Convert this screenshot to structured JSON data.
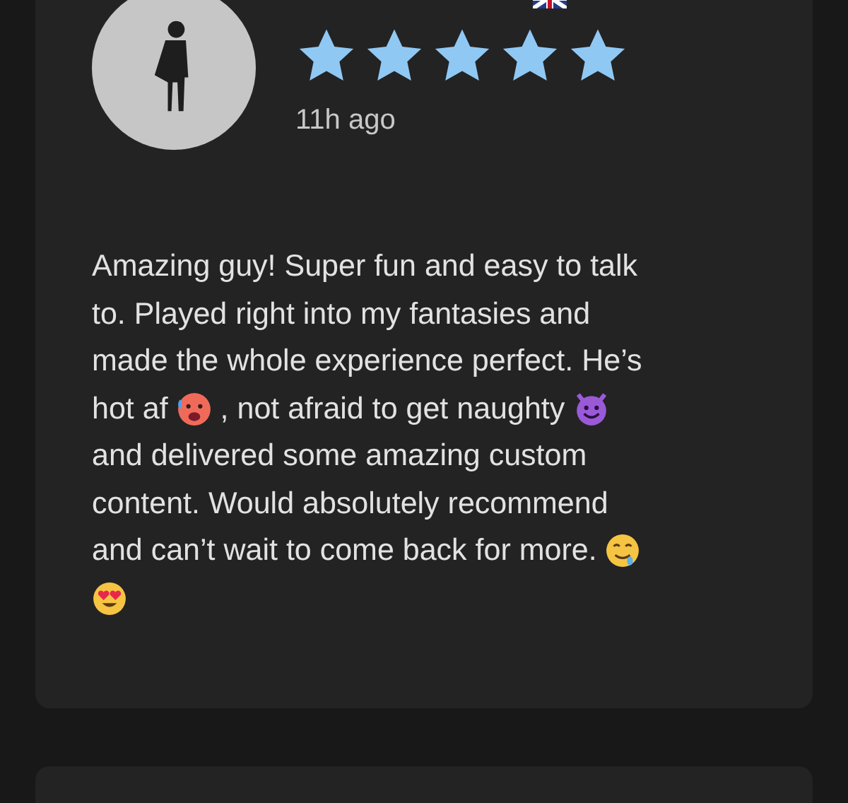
{
  "review": {
    "stars": 5,
    "time": "11h ago",
    "lines": [
      [
        {
          "kind": "text",
          "text": "Amazing guy! Super fun and easy to talk"
        }
      ],
      [
        {
          "kind": "text",
          "text": "to. Played right into my fantasies and"
        }
      ],
      [
        {
          "kind": "text",
          "text": "made the whole experience perfect. He’s"
        }
      ],
      [
        {
          "kind": "text",
          "text": "hot af"
        },
        {
          "kind": "hot"
        },
        {
          "kind": "text",
          "text": ", not afraid to get naughty"
        },
        {
          "kind": "devil"
        }
      ],
      [
        {
          "kind": "text",
          "text": "and delivered some amazing custom"
        }
      ],
      [
        {
          "kind": "text",
          "text": "content. Would absolutely recommend"
        }
      ],
      [
        {
          "kind": "text",
          "text": "and can’t wait to come back for more."
        },
        {
          "kind": "drool"
        }
      ],
      [
        {
          "kind": "hearteyes"
        }
      ]
    ]
  }
}
